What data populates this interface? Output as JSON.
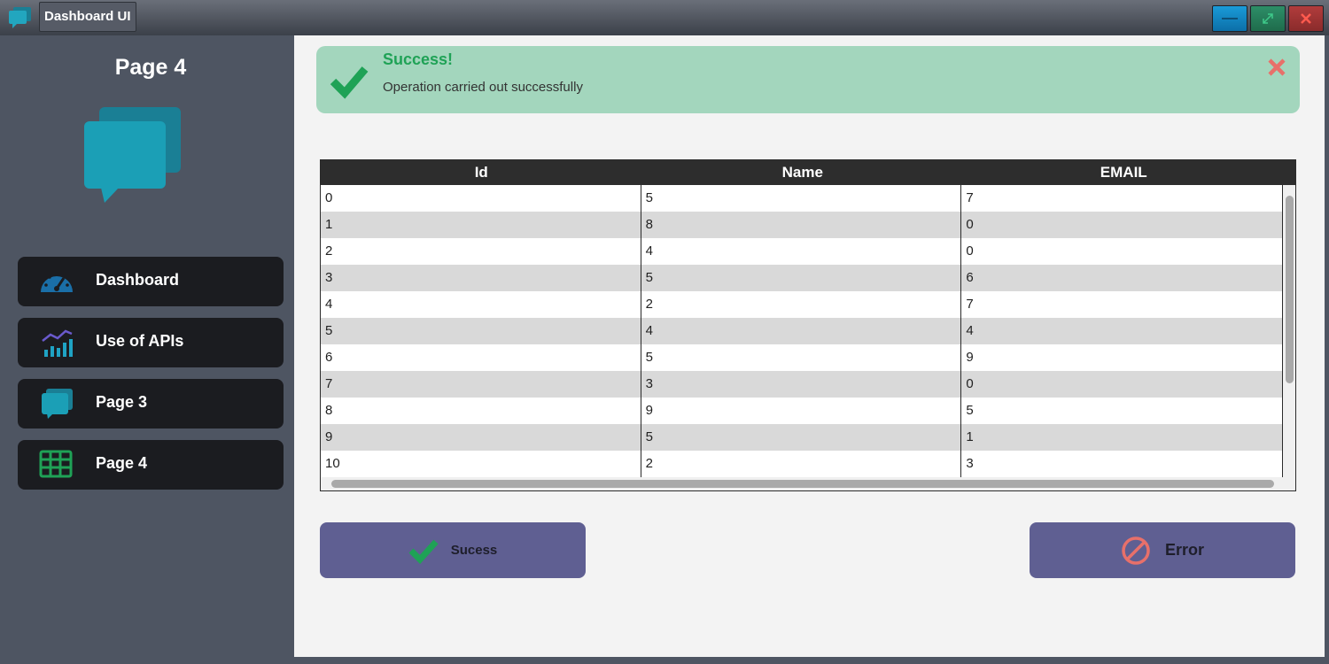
{
  "window": {
    "title": "Dashboard UI",
    "colors": {
      "minimize": "#1a9bd8",
      "maximize": "#2d8e67",
      "close": "#b13c3c"
    }
  },
  "sidebar": {
    "title": "Page 4",
    "hero_icon": "chat-bubbles-icon",
    "items": [
      {
        "label": "Dashboard",
        "icon": "speedometer-icon"
      },
      {
        "label": "Use of APIs",
        "icon": "bar-chart-icon"
      },
      {
        "label": "Page 3",
        "icon": "chat-bubbles-icon"
      },
      {
        "label": "Page 4",
        "icon": "table-icon"
      }
    ]
  },
  "alert": {
    "title": "Success!",
    "message": "Operation carried out successfully",
    "icon": "check-icon",
    "close_icon": "close-icon",
    "background": "#a3d6bd",
    "title_color": "#1fa256"
  },
  "table": {
    "columns": [
      "Id",
      "Name",
      "EMAIL"
    ],
    "rows": [
      [
        "0",
        "5",
        "7"
      ],
      [
        "1",
        "8",
        "0"
      ],
      [
        "2",
        "4",
        "0"
      ],
      [
        "3",
        "5",
        "6"
      ],
      [
        "4",
        "2",
        "7"
      ],
      [
        "5",
        "4",
        "4"
      ],
      [
        "6",
        "5",
        "9"
      ],
      [
        "7",
        "3",
        "0"
      ],
      [
        "8",
        "9",
        "5"
      ],
      [
        "9",
        "5",
        "1"
      ],
      [
        "10",
        "2",
        "3"
      ]
    ]
  },
  "buttons": {
    "success_label": "Sucess",
    "error_label": "Error",
    "background": "#5f5f92"
  }
}
